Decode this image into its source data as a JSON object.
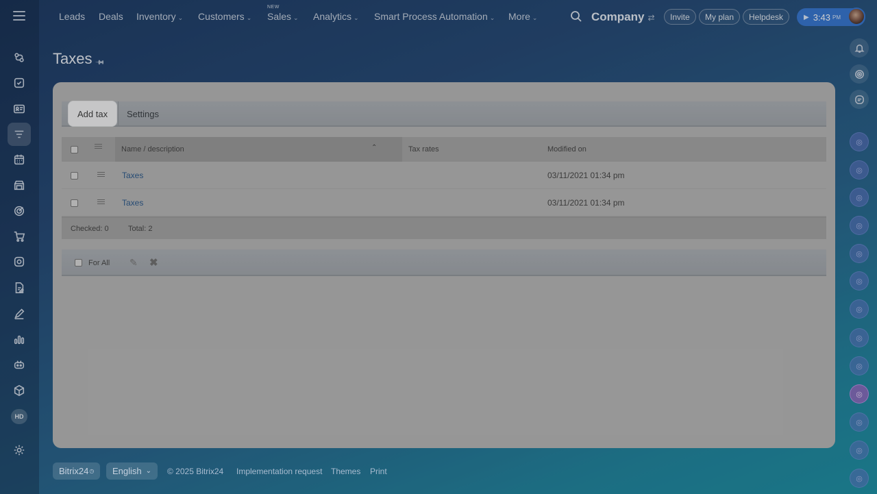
{
  "nav": {
    "items": [
      {
        "label": "Leads",
        "has_dropdown": false
      },
      {
        "label": "Deals",
        "has_dropdown": false
      },
      {
        "label": "Inventory",
        "has_dropdown": true
      },
      {
        "label": "Customers",
        "has_dropdown": true
      },
      {
        "label": "Sales",
        "has_dropdown": true,
        "badge": "NEW"
      },
      {
        "label": "Analytics",
        "has_dropdown": true
      },
      {
        "label": "Smart Process Automation",
        "has_dropdown": true
      },
      {
        "label": "More",
        "has_dropdown": true
      }
    ],
    "company": "Company",
    "invite": "Invite",
    "my_plan": "My plan",
    "helpdesk": "Helpdesk",
    "clock_time": "3:43",
    "clock_ampm": "PM"
  },
  "sidebar": {
    "icons": [
      "crm-icon",
      "tasks-icon",
      "contact-center-icon",
      "filter-icon",
      "calendar-icon",
      "store-icon",
      "target-icon",
      "cart-icon",
      "support-icon",
      "document-icon",
      "sign-icon",
      "analytics-icon",
      "robot-icon",
      "box-icon"
    ],
    "hd_label": "HD"
  },
  "page": {
    "title": "Taxes"
  },
  "toolbar": {
    "add_tax_label": "Add tax",
    "settings_label": "Settings"
  },
  "grid": {
    "columns": [
      "Name / description",
      "Tax rates",
      "Modified on"
    ],
    "rows": [
      {
        "name": "Taxes",
        "rates": "",
        "modified": "03/11/2021 01:34 pm"
      },
      {
        "name": "Taxes",
        "rates": "",
        "modified": "03/11/2021 01:34 pm"
      }
    ],
    "checked_label": "Checked: 0",
    "total_label": "Total: 2"
  },
  "actionbar": {
    "for_all_label": "For All"
  },
  "footer": {
    "brand": "Bitrix24",
    "language": "English",
    "copyright": "© 2025 Bitrix24",
    "links": [
      "Implementation request",
      "Themes",
      "Print"
    ]
  },
  "colors": {
    "clock_bg": "#2a6fd0",
    "link": "#1e4f86",
    "highlight_avatar": "#aa5ac8"
  }
}
